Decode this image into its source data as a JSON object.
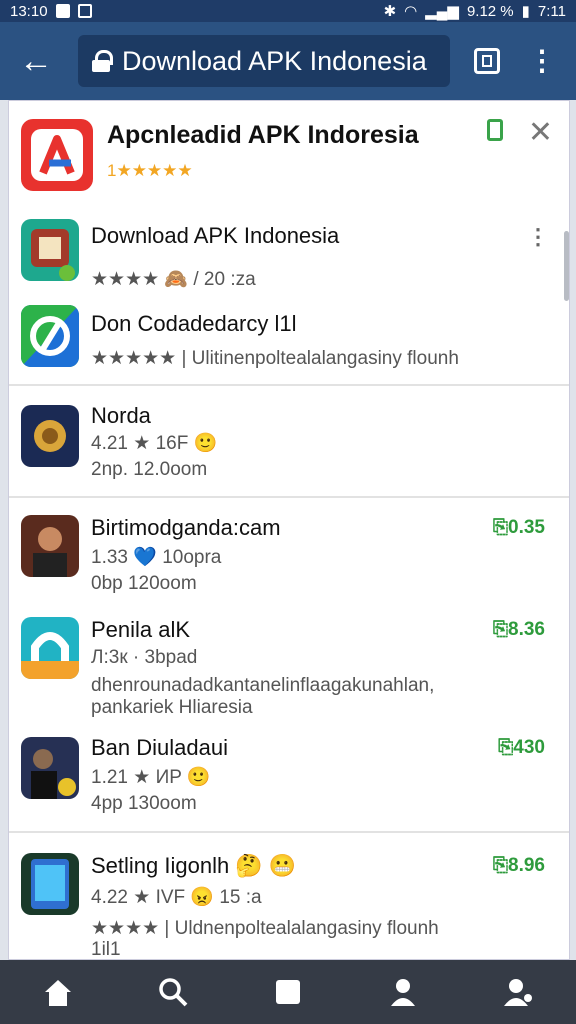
{
  "statusbar": {
    "time_left": "13:10",
    "battery_text": "9.12 %",
    "time_right": "7:11"
  },
  "browser": {
    "url_title": "Download APK Indonesia"
  },
  "header_app": {
    "title": "Apcnleadid APK Indoresia",
    "rating": "1★★★★★"
  },
  "apps": [
    {
      "title": "Download APK Indonesia",
      "meta": "★★★★ 🙈 / 20 :za",
      "price": ""
    },
    {
      "title": "Don Codadedarcy l1l",
      "meta": "★★★★★ | Ulitinenpoltealalangasiny flounh",
      "price": ""
    },
    {
      "title": "Norda",
      "meta": "4.21 ★ 16F 🙂",
      "meta2": "2np. 12.0oom",
      "price": ""
    },
    {
      "title": "Birtimodganda:cam",
      "meta": "1.33 💙 10opra",
      "meta2": "0bp 120oom",
      "price": "⎘0.35"
    },
    {
      "title": "Penila alK",
      "meta": "Л:3к · 3bpad",
      "meta2": "dhenrounadadkantanelinflaagakunahlan,",
      "meta3": "pankariek Hliaresia",
      "price": "⎘8.36"
    },
    {
      "title": "Ban Diuladaui",
      "meta": "1.21 ★ ИP 🙂",
      "meta2": "4pp 130oom",
      "price": "⎘430"
    },
    {
      "title": "Setling Iigonlh 🤔 😬",
      "meta": "4.22 ★ IVF 😠 15 :a",
      "meta2": "★★★★ | Uldnenpoltealalangasiny flounh",
      "meta3": "1il1",
      "price": "⎘8.96"
    }
  ],
  "colors": {
    "topbar": "#2b5282",
    "accent_green": "#2e9b3c",
    "star": "#f2a623"
  },
  "bottom_nav": [
    "home-icon",
    "search-icon",
    "square-icon",
    "person-icon",
    "profile-icon"
  ]
}
